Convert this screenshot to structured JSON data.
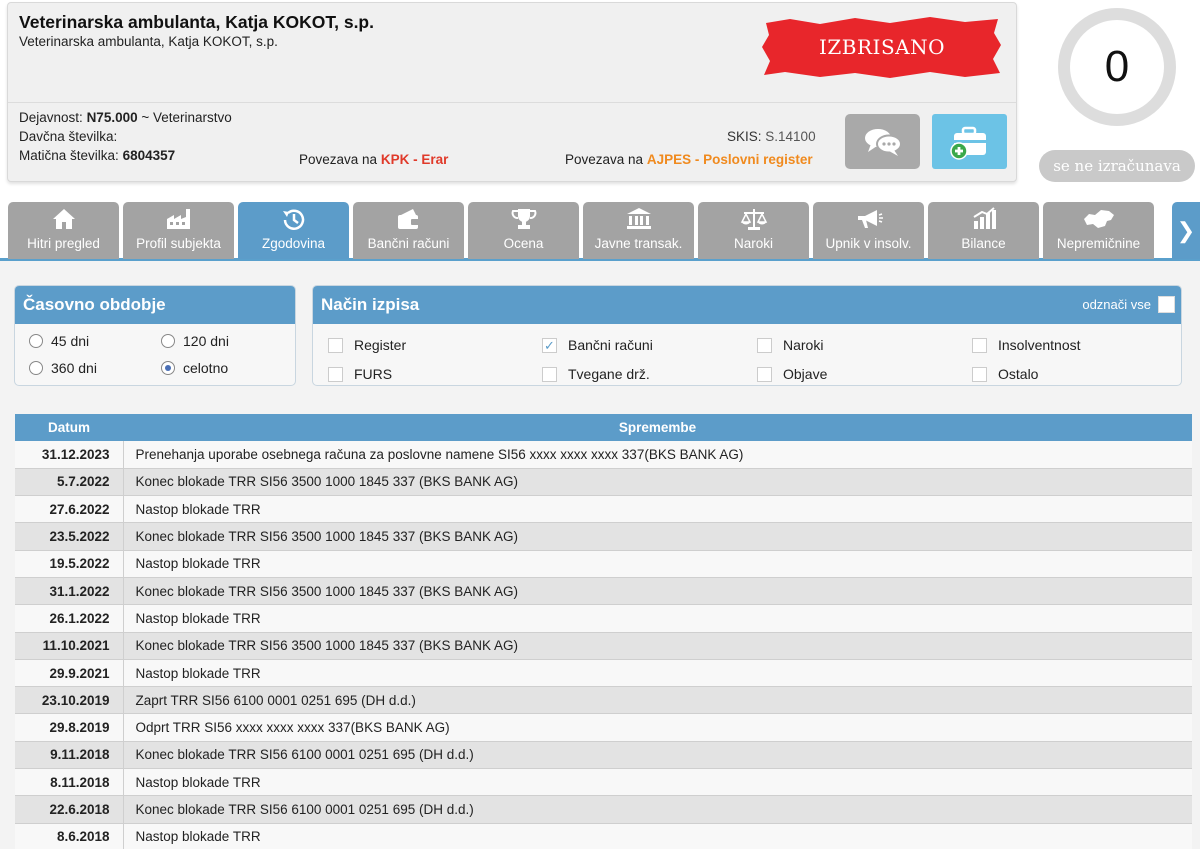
{
  "header": {
    "company_name": "Veterinarska ambulanta, Katja KOKOT, s.p.",
    "company_subtitle": "Veterinarska ambulanta, Katja KOKOT, s.p.",
    "status_stamp": "IZBRISANO",
    "activity_label": "Dejavnost:",
    "activity_code": "N75.000",
    "activity_desc": "~ Veterinarstvo",
    "tax_label": "Davčna številka:",
    "reg_label": "Matična številka:",
    "reg_number": "6804357",
    "skis_label": "SKIS:",
    "skis_value": "S.14100",
    "kpk_prefix": "Povezava na",
    "kpk_link": "KPK - Erar",
    "ajpes_prefix": "Povezava na",
    "ajpes_link": "AJPES - Poslovni register"
  },
  "score": {
    "value": "0",
    "status": "se ne izračunava"
  },
  "tabs": [
    {
      "label": "Hitri pregled",
      "icon": "home-icon"
    },
    {
      "label": "Profil subjekta",
      "icon": "factory-icon"
    },
    {
      "label": "Zgodovina",
      "icon": "history-icon",
      "active": true
    },
    {
      "label": "Bančni računi",
      "icon": "wallet-icon"
    },
    {
      "label": "Ocena",
      "icon": "trophy-icon"
    },
    {
      "label": "Javne transak.",
      "icon": "institution-icon"
    },
    {
      "label": "Naroki",
      "icon": "scales-icon"
    },
    {
      "label": "Upnik v insolv.",
      "icon": "megaphone-icon"
    },
    {
      "label": "Bilance",
      "icon": "bar-chart-icon"
    },
    {
      "label": "Nepremičnine",
      "icon": "slovenia-map-icon"
    }
  ],
  "time_period": {
    "title": "Časovno obdobje",
    "options": [
      "45 dni",
      "120 dni",
      "360 dni",
      "celotno"
    ],
    "selected": "celotno"
  },
  "output_mode": {
    "title": "Način izpisa",
    "select_all": "odznači vse",
    "options": [
      {
        "label": "Register",
        "checked": false
      },
      {
        "label": "Bančni računi",
        "checked": true
      },
      {
        "label": "Naroki",
        "checked": false
      },
      {
        "label": "Insolventnost",
        "checked": false
      },
      {
        "label": "FURS",
        "checked": false
      },
      {
        "label": "Tvegane drž.",
        "checked": false
      },
      {
        "label": "Objave",
        "checked": false
      },
      {
        "label": "Ostalo",
        "checked": false
      }
    ]
  },
  "table": {
    "headers": [
      "Datum",
      "Spremembe"
    ],
    "rows": [
      [
        "31.12.2023",
        "Prenehanja uporabe osebnega računa za poslovne namene SI56 xxxx xxxx xxxx 337(BKS BANK AG)"
      ],
      [
        "5.7.2022",
        "Konec blokade TRR SI56 3500 1000 1845 337 (BKS BANK AG)"
      ],
      [
        "27.6.2022",
        "Nastop blokade TRR"
      ],
      [
        "23.5.2022",
        "Konec blokade TRR SI56 3500 1000 1845 337 (BKS BANK AG)"
      ],
      [
        "19.5.2022",
        "Nastop blokade TRR"
      ],
      [
        "31.1.2022",
        "Konec blokade TRR SI56 3500 1000 1845 337 (BKS BANK AG)"
      ],
      [
        "26.1.2022",
        "Nastop blokade TRR"
      ],
      [
        "11.10.2021",
        "Konec blokade TRR SI56 3500 1000 1845 337 (BKS BANK AG)"
      ],
      [
        "29.9.2021",
        "Nastop blokade TRR"
      ],
      [
        "23.10.2019",
        "Zaprt TRR SI56 6100 0001 0251 695 (DH d.d.)"
      ],
      [
        "29.8.2019",
        "Odprt TRR SI56 xxxx xxxx xxxx 337(BKS BANK AG)"
      ],
      [
        "9.11.2018",
        "Konec blokade TRR SI56 6100 0001 0251 695 (DH d.d.)"
      ],
      [
        "8.11.2018",
        "Nastop blokade TRR"
      ],
      [
        "22.6.2018",
        "Konec blokade TRR SI56 6100 0001 0251 695 (DH d.d.)"
      ],
      [
        "8.6.2018",
        "Nastop blokade TRR"
      ]
    ]
  },
  "colors": {
    "accent": "#5c9cc9",
    "tab_inactive": "#a3a3a3",
    "stamp_red": "#e8262b",
    "kpk_link": "#e03a2a",
    "ajpes_link": "#f08a1e"
  }
}
